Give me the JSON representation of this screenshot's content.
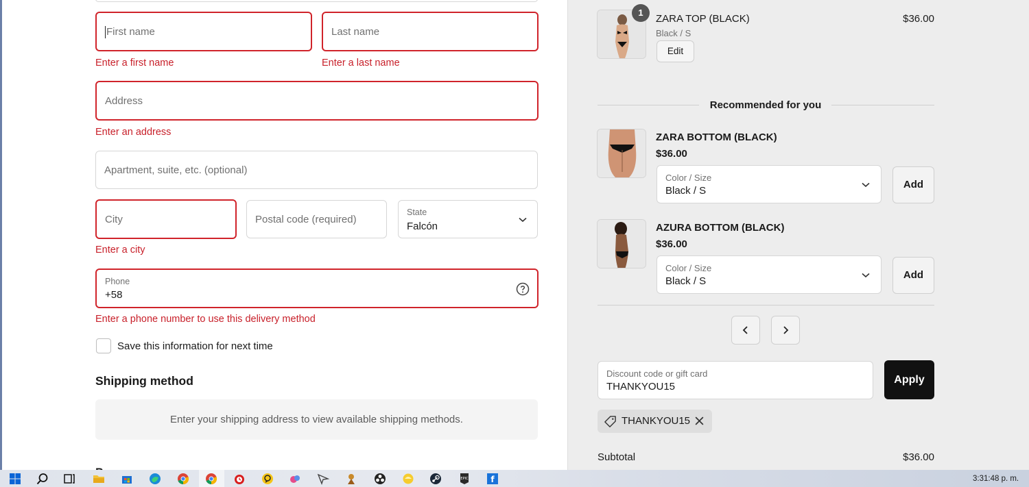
{
  "form": {
    "first_name_placeholder": "First name",
    "first_name_error": "Enter a first name",
    "last_name_placeholder": "Last name",
    "last_name_error": "Enter a last name",
    "address_placeholder": "Address",
    "address_error": "Enter an address",
    "apartment_placeholder": "Apartment, suite, etc. (optional)",
    "city_placeholder": "City",
    "city_error": "Enter a city",
    "postal_placeholder": "Postal code (required)",
    "state_label": "State",
    "state_value": "Falcón",
    "phone_label": "Phone",
    "phone_value": "+58",
    "phone_error": "Enter a phone number to use this delivery method",
    "save_info_label": "Save this information for next time",
    "save_info_checked": false
  },
  "shipping": {
    "title": "Shipping method",
    "message": "Enter your shipping address to view available shipping methods."
  },
  "cart": {
    "item": {
      "quantity": "1",
      "name": "ZARA TOP (BLACK)",
      "variant": "Black / S",
      "price": "$36.00",
      "edit_label": "Edit"
    },
    "recommended_title": "Recommended for you",
    "recommendations": [
      {
        "name": "ZARA BOTTOM (BLACK)",
        "price": "$36.00",
        "select_label": "Color / Size",
        "select_value": "Black / S",
        "add_label": "Add"
      },
      {
        "name": "AZURA BOTTOM (BLACK)",
        "price": "$36.00",
        "select_label": "Color / Size",
        "select_value": "Black / S",
        "add_label": "Add"
      }
    ],
    "discount": {
      "label": "Discount code or gift card",
      "value": "THANKYOU15",
      "apply_label": "Apply",
      "applied_code": "THANKYOU15"
    },
    "subtotal_label": "Subtotal",
    "subtotal_value": "$36.00"
  },
  "taskbar": {
    "clock": "3:31:48 p. m."
  },
  "colors": {
    "error": "#c8202a",
    "button_dark": "#111111",
    "summary_bg": "#ededed"
  }
}
